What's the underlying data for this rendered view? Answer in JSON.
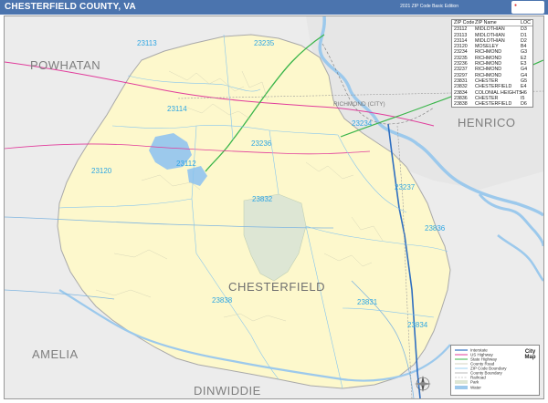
{
  "header": {
    "title": "CHESTERFIELD COUNTY, VA",
    "edition": "2021 ZIP Code Basic Edition"
  },
  "colors": {
    "header_bg": "#4b74ae",
    "county_fill": "#fdf8cc",
    "outside_fill": "#ececec",
    "zip_label": "#2ea6e3",
    "water": "#9cc9ec",
    "park": "#dde6d4"
  },
  "counties": {
    "powhatan": "POWHATAN",
    "henrico": "HENRICO",
    "amelia": "AMELIA",
    "dinwiddie": "DINWIDDIE",
    "chesterfield": "CHESTERFIELD"
  },
  "cities": {
    "richmond_city": "RICHMOND (CITY)"
  },
  "zip_labels": {
    "z23113": "23113",
    "z23235": "23235",
    "z23114": "23114",
    "z23234": "23234",
    "z23236": "23236",
    "z23120": "23120",
    "z23112": "23112",
    "z23237": "23237",
    "z23832": "23832",
    "z23836": "23836",
    "z23838": "23838",
    "z23831": "23831",
    "z23834": "23834"
  },
  "zip_table": {
    "headers": [
      "ZIP Code",
      "ZIP Name",
      "LOC"
    ],
    "rows": [
      [
        "23112",
        "MIDLOTHIAN",
        "D3"
      ],
      [
        "23113",
        "MIDLOTHIAN",
        "D1"
      ],
      [
        "23114",
        "MIDLOTHIAN",
        "D2"
      ],
      [
        "23120",
        "MOSELEY",
        "B4"
      ],
      [
        "23234",
        "RICHMOND",
        "G3"
      ],
      [
        "23235",
        "RICHMOND",
        "E2"
      ],
      [
        "23236",
        "RICHMOND",
        "E3"
      ],
      [
        "23237",
        "RICHMOND",
        "G4"
      ],
      [
        "23297",
        "RICHMOND",
        "G4"
      ],
      [
        "23831",
        "CHESTER",
        "G5"
      ],
      [
        "23832",
        "CHESTERFIELD",
        "E4"
      ],
      [
        "23834",
        "COLONIAL HEIGHTS",
        "H6"
      ],
      [
        "23836",
        "CHESTER",
        "I5"
      ],
      [
        "23838",
        "CHESTERFIELD",
        "D6"
      ]
    ]
  },
  "legend": {
    "logo": "City Map",
    "items": [
      "Interstate",
      "US Highway",
      "State Highway",
      "County Road",
      "ZIP Code Boundary",
      "County Boundary",
      "Railroad",
      "Park",
      "Water"
    ]
  },
  "icons": {
    "north_arrow": "compass-icon"
  }
}
